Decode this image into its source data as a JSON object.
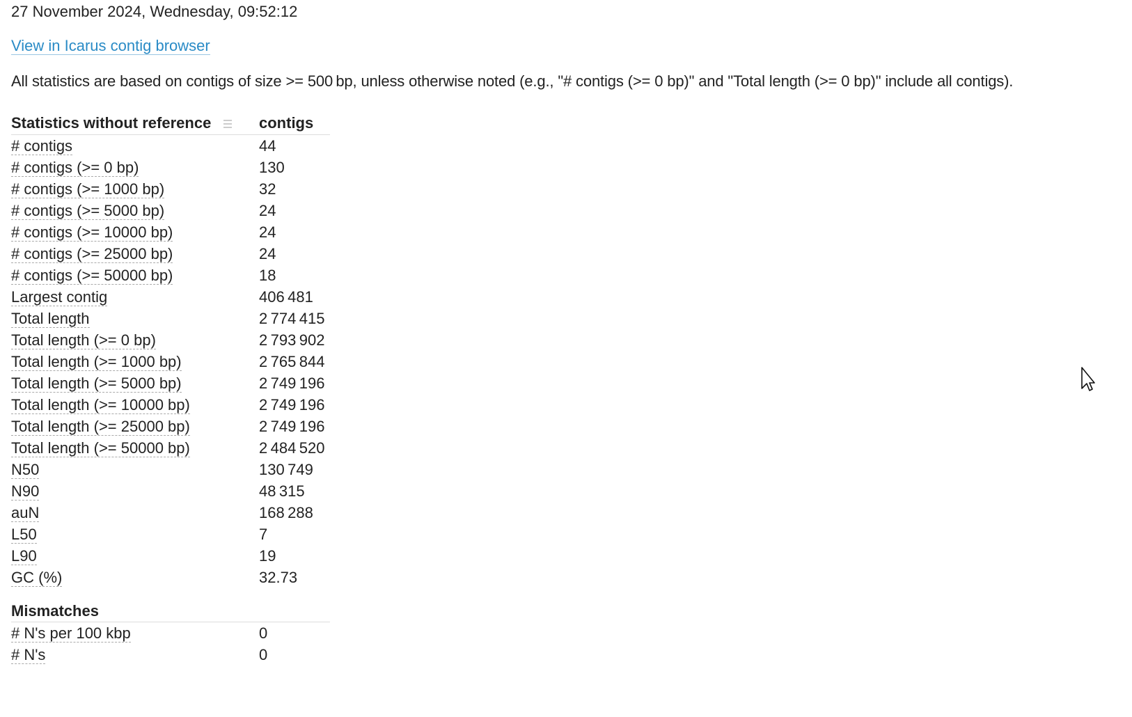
{
  "report_date": "27 November 2024, Wednesday, 09:52:12",
  "icarus_link": "View in Icarus contig browser",
  "notice": "All statistics are based on contigs of size >= 500 bp, unless otherwise noted (e.g., \"# contigs (>= 0 bp)\" and \"Total length (>= 0 bp)\" include all contigs).",
  "table": {
    "group1_header": "Statistics without reference",
    "column_header": "contigs",
    "group1_rows": [
      {
        "metric": "# contigs",
        "value": "44"
      },
      {
        "metric": "# contigs (>= 0 bp)",
        "value": "130"
      },
      {
        "metric": "# contigs (>= 1000 bp)",
        "value": "32"
      },
      {
        "metric": "# contigs (>= 5000 bp)",
        "value": "24"
      },
      {
        "metric": "# contigs (>= 10000 bp)",
        "value": "24"
      },
      {
        "metric": "# contigs (>= 25000 bp)",
        "value": "24"
      },
      {
        "metric": "# contigs (>= 50000 bp)",
        "value": "18"
      },
      {
        "metric": "Largest contig",
        "value": "406 481"
      },
      {
        "metric": "Total length",
        "value": "2 774 415"
      },
      {
        "metric": "Total length (>= 0 bp)",
        "value": "2 793 902"
      },
      {
        "metric": "Total length (>= 1000 bp)",
        "value": "2 765 844"
      },
      {
        "metric": "Total length (>= 5000 bp)",
        "value": "2 749 196"
      },
      {
        "metric": "Total length (>= 10000 bp)",
        "value": "2 749 196"
      },
      {
        "metric": "Total length (>= 25000 bp)",
        "value": "2 749 196"
      },
      {
        "metric": "Total length (>= 50000 bp)",
        "value": "2 484 520"
      },
      {
        "metric": "N50",
        "value": "130 749"
      },
      {
        "metric": "N90",
        "value": "48 315"
      },
      {
        "metric": "auN",
        "value": "168 288"
      },
      {
        "metric": "L50",
        "value": "7"
      },
      {
        "metric": "L90",
        "value": "19"
      },
      {
        "metric": "GC (%)",
        "value": "32.73"
      }
    ],
    "group2_header": "Mismatches",
    "group2_rows": [
      {
        "metric": "# N's per 100 kbp",
        "value": "0"
      },
      {
        "metric": "# N's",
        "value": "0"
      }
    ]
  },
  "icons": {
    "drag_handle": "drag-handle-icon",
    "cursor": "mouse-pointer-icon"
  }
}
